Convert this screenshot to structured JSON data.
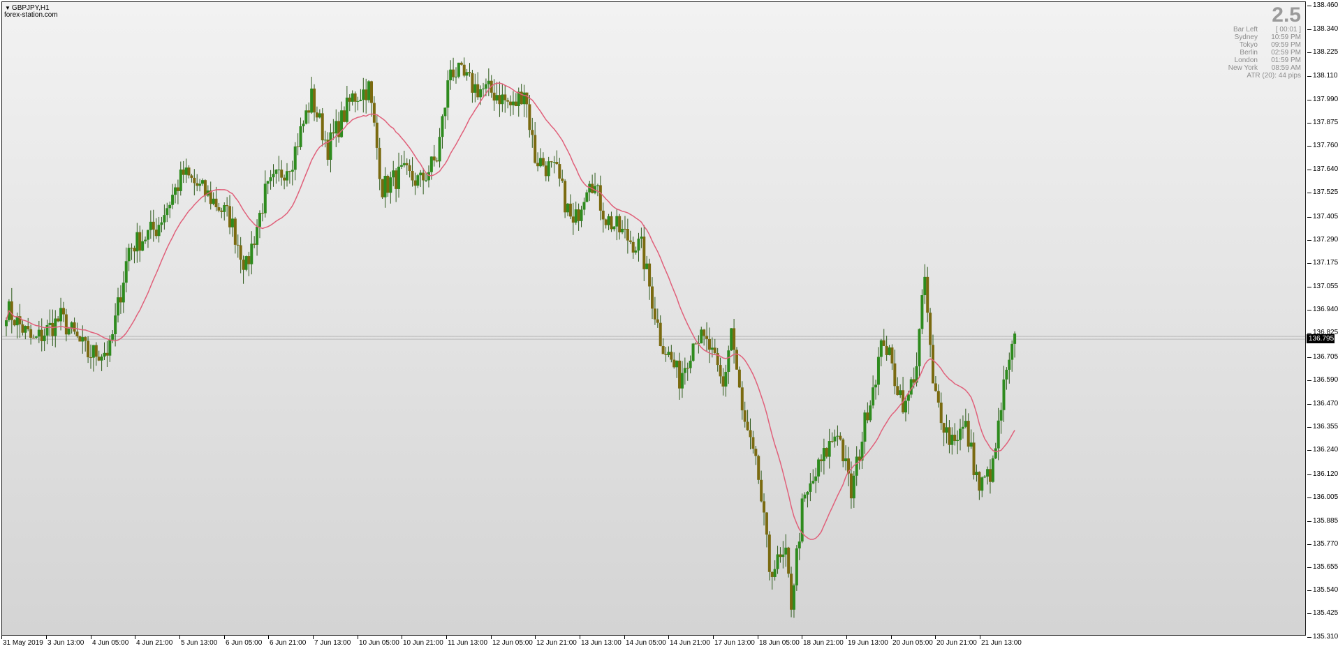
{
  "chart_header": {
    "symbol": "GBPJPY,H1",
    "site": "forex-station.com"
  },
  "info_panel": {
    "big_value": "2.5",
    "rows": [
      {
        "label": "Bar Left",
        "value": "[ 00:01 ]"
      },
      {
        "label": "Sydney",
        "value": "10:59 PM"
      },
      {
        "label": "Tokyo",
        "value": "09:59 PM"
      },
      {
        "label": "Berlin",
        "value": "02:59 PM"
      },
      {
        "label": "London",
        "value": "01:59 PM"
      },
      {
        "label": "New York",
        "value": "08:59 AM"
      }
    ],
    "atr": "ATR (20): 44 pips"
  },
  "colors": {
    "up_candle": "#2e8b1e",
    "down_candle": "#7a6a10",
    "moving_average": "#e0607a",
    "background_top": "#f2f2f2",
    "background_bottom": "#d4d4d4"
  },
  "chart_data": {
    "type": "candlestick",
    "symbol": "GBPJPY",
    "timeframe": "H1",
    "current_price": "136.795",
    "y_ticks": [
      "138.460",
      "138.340",
      "138.225",
      "138.110",
      "137.990",
      "137.875",
      "137.760",
      "137.640",
      "137.525",
      "137.405",
      "137.290",
      "137.175",
      "137.055",
      "136.940",
      "136.825",
      "136.705",
      "136.590",
      "136.470",
      "136.355",
      "136.240",
      "136.120",
      "136.005",
      "135.885",
      "135.770",
      "135.655",
      "135.540",
      "135.425",
      "135.310"
    ],
    "x_labels": [
      "31 May 2019",
      "3 Jun 13:00",
      "4 Jun 05:00",
      "4 Jun 21:00",
      "5 Jun 13:00",
      "6 Jun 05:00",
      "6 Jun 21:00",
      "7 Jun 13:00",
      "10 Jun 05:00",
      "10 Jun 21:00",
      "11 Jun 13:00",
      "12 Jun 05:00",
      "12 Jun 21:00",
      "13 Jun 13:00",
      "14 Jun 05:00",
      "14 Jun 21:00",
      "17 Jun 13:00",
      "18 Jun 05:00",
      "18 Jun 21:00",
      "19 Jun 13:00",
      "20 Jun 05:00",
      "20 Jun 21:00",
      "21 Jun 13:00"
    ],
    "price_path": [
      {
        "bar": 0,
        "price": 136.95
      },
      {
        "bar": 10,
        "price": 136.78
      },
      {
        "bar": 20,
        "price": 136.9
      },
      {
        "bar": 30,
        "price": 136.72
      },
      {
        "bar": 38,
        "price": 136.74
      },
      {
        "bar": 45,
        "price": 137.25
      },
      {
        "bar": 55,
        "price": 137.35
      },
      {
        "bar": 65,
        "price": 137.62
      },
      {
        "bar": 75,
        "price": 137.5
      },
      {
        "bar": 82,
        "price": 137.4
      },
      {
        "bar": 88,
        "price": 137.15
      },
      {
        "bar": 95,
        "price": 137.52
      },
      {
        "bar": 105,
        "price": 137.7
      },
      {
        "bar": 112,
        "price": 138.0
      },
      {
        "bar": 118,
        "price": 137.75
      },
      {
        "bar": 127,
        "price": 138.0
      },
      {
        "bar": 133,
        "price": 138.05
      },
      {
        "bar": 138,
        "price": 137.55
      },
      {
        "bar": 145,
        "price": 137.62
      },
      {
        "bar": 152,
        "price": 137.58
      },
      {
        "bar": 158,
        "price": 137.7
      },
      {
        "bar": 163,
        "price": 138.15
      },
      {
        "bar": 172,
        "price": 138.05
      },
      {
        "bar": 180,
        "price": 138.02
      },
      {
        "bar": 186,
        "price": 137.95
      },
      {
        "bar": 190,
        "price": 138.05
      },
      {
        "bar": 194,
        "price": 137.7
      },
      {
        "bar": 202,
        "price": 137.62
      },
      {
        "bar": 208,
        "price": 137.35
      },
      {
        "bar": 214,
        "price": 137.62
      },
      {
        "bar": 220,
        "price": 137.4
      },
      {
        "bar": 228,
        "price": 137.3
      },
      {
        "bar": 233,
        "price": 137.25
      },
      {
        "bar": 240,
        "price": 136.8
      },
      {
        "bar": 247,
        "price": 136.6
      },
      {
        "bar": 253,
        "price": 136.82
      },
      {
        "bar": 258,
        "price": 136.75
      },
      {
        "bar": 263,
        "price": 136.55
      },
      {
        "bar": 266,
        "price": 136.85
      },
      {
        "bar": 270,
        "price": 136.42
      },
      {
        "bar": 276,
        "price": 136.1
      },
      {
        "bar": 280,
        "price": 135.65
      },
      {
        "bar": 286,
        "price": 135.7
      },
      {
        "bar": 288,
        "price": 135.48
      },
      {
        "bar": 292,
        "price": 135.95
      },
      {
        "bar": 298,
        "price": 136.15
      },
      {
        "bar": 305,
        "price": 136.35
      },
      {
        "bar": 310,
        "price": 136.02
      },
      {
        "bar": 316,
        "price": 136.45
      },
      {
        "bar": 322,
        "price": 136.8
      },
      {
        "bar": 326,
        "price": 136.6
      },
      {
        "bar": 330,
        "price": 136.45
      },
      {
        "bar": 334,
        "price": 136.68
      },
      {
        "bar": 337,
        "price": 137.1
      },
      {
        "bar": 340,
        "price": 136.55
      },
      {
        "bar": 346,
        "price": 136.3
      },
      {
        "bar": 352,
        "price": 136.35
      },
      {
        "bar": 357,
        "price": 136.05
      },
      {
        "bar": 362,
        "price": 136.15
      },
      {
        "bar": 366,
        "price": 136.55
      },
      {
        "bar": 370,
        "price": 136.78
      }
    ],
    "moving_average_period": 20,
    "moving_average_type": "line",
    "grid": false
  }
}
